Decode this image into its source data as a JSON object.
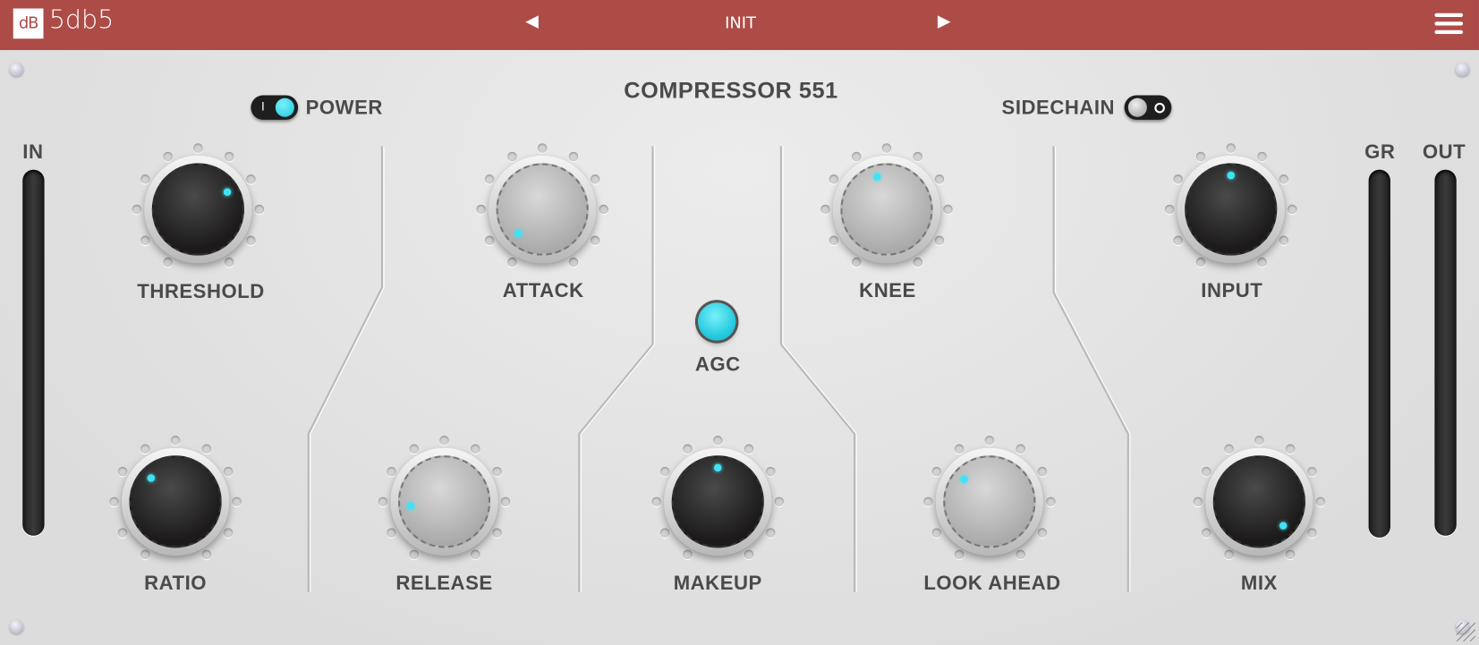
{
  "header": {
    "logo": "dB",
    "brand": "5db5",
    "preset": "INIT",
    "prev_icon": "triangle-left",
    "next_icon": "triangle-right",
    "menu_icon": "hamburger"
  },
  "panel": {
    "title": "COMPRESSOR 551",
    "power": {
      "label": "POWER",
      "on": true,
      "mark": "I"
    },
    "sidechain": {
      "label": "SIDECHAIN",
      "on": false
    },
    "agc": {
      "label": "AGC",
      "on": true
    },
    "meters": {
      "in": "IN",
      "gr": "GR",
      "out": "OUT"
    }
  },
  "knobs": [
    {
      "id": "threshold",
      "label": "THRESHOLD",
      "value": 0.72,
      "style": "dark"
    },
    {
      "id": "attack",
      "label": "ATTACK",
      "value": 0.0,
      "style": "gray"
    },
    {
      "id": "knee",
      "label": "KNEE",
      "value": 0.44,
      "style": "gray"
    },
    {
      "id": "input",
      "label": "INPUT",
      "value": 0.5,
      "style": "dark"
    },
    {
      "id": "ratio",
      "label": "RATIO",
      "value": 0.33,
      "style": "dark"
    },
    {
      "id": "release",
      "label": "RELEASE",
      "value": 0.14,
      "style": "gray"
    },
    {
      "id": "makeup",
      "label": "MAKEUP",
      "value": 0.5,
      "style": "dark"
    },
    {
      "id": "look-ahead",
      "label": "LOOK  AHEAD",
      "value": 0.32,
      "style": "gray"
    },
    {
      "id": "mix",
      "label": "MIX",
      "value": 1.0,
      "style": "dark"
    }
  ],
  "colors": {
    "header": "#ad4b47",
    "accent": "#3fe3f5"
  }
}
